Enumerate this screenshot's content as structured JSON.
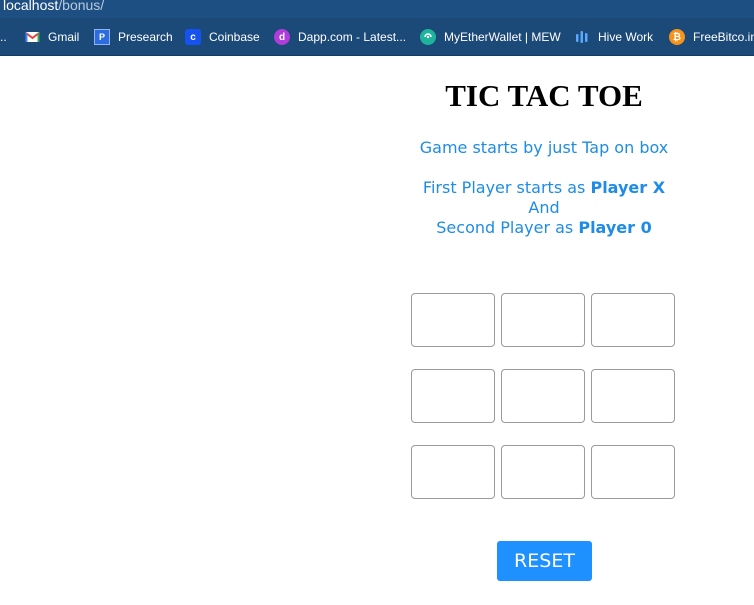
{
  "browser": {
    "url_host": "localhost",
    "url_path": "/bonus/",
    "bookmarks": [
      {
        "label": "..",
        "icon": "overflow-icon",
        "color": "#1b4978"
      },
      {
        "label": "Gmail",
        "icon": "gmail-icon",
        "color": "#ea4335"
      },
      {
        "label": "Presearch",
        "icon": "presearch-icon",
        "color": "#2d6cdf"
      },
      {
        "label": "Coinbase",
        "icon": "coinbase-icon",
        "color": "#1652f0"
      },
      {
        "label": "Dapp.com - Latest...",
        "icon": "dapp-icon",
        "color": "#b03cdc"
      },
      {
        "label": "MyEtherWallet | MEW",
        "icon": "mew-icon",
        "color": "#1fb39b"
      },
      {
        "label": "Hive Work",
        "icon": "hive-icon",
        "color": "#1e90ff"
      },
      {
        "label": "FreeBitco.in",
        "icon": "bitcoin-icon",
        "color": "#f7931a"
      }
    ]
  },
  "game": {
    "title": "TIC TAC TOE",
    "instruction": "Game starts by just Tap on box",
    "line1_prefix": "First Player starts as ",
    "line1_player": "Player X",
    "line2": "And",
    "line3_prefix": "Second Player as ",
    "line3_player": "Player 0",
    "cells": [
      "",
      "",
      "",
      "",
      "",
      "",
      "",
      "",
      ""
    ],
    "reset_label": "RESET"
  },
  "colors": {
    "accent": "#1e8ce6",
    "button": "#1e90ff",
    "chrome": "#1b4978"
  }
}
